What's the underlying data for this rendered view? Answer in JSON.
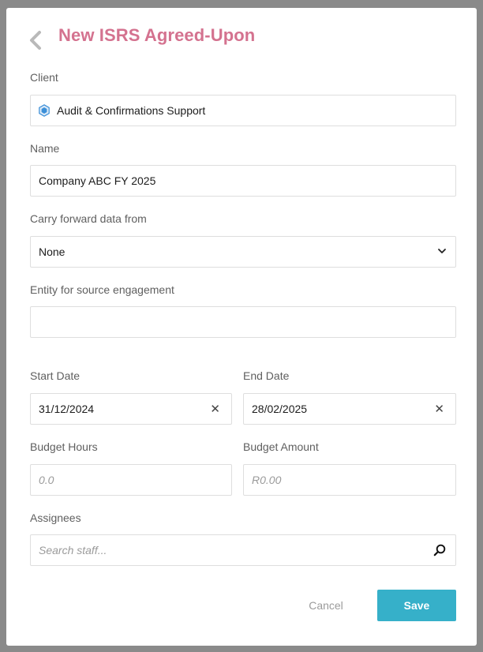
{
  "modal": {
    "title": "New ISRS Agreed-Upon",
    "back_icon": "chevron-left-icon"
  },
  "form": {
    "client": {
      "label": "Client",
      "value": "Audit & Confirmations Support",
      "icon": "hexagon-icon",
      "icon_color": "#3b8fd8"
    },
    "name": {
      "label": "Name",
      "value": "Company ABC FY 2025"
    },
    "carry_forward": {
      "label": "Carry forward data from",
      "selected": "None"
    },
    "entity_source": {
      "label": "Entity for source engagement",
      "value": ""
    },
    "start_date": {
      "label": "Start Date",
      "value": "31/12/2024"
    },
    "end_date": {
      "label": "End Date",
      "value": "28/02/2025"
    },
    "budget_hours": {
      "label": "Budget Hours",
      "placeholder": "0.0"
    },
    "budget_amount": {
      "label": "Budget Amount",
      "placeholder": "R0.00"
    },
    "assignees": {
      "label": "Assignees",
      "placeholder": "Search staff..."
    }
  },
  "actions": {
    "cancel_label": "Cancel",
    "save_label": "Save"
  },
  "colors": {
    "title": "#d4728f",
    "save_button": "#36b0c9",
    "overlay": "#8a8a8a"
  }
}
